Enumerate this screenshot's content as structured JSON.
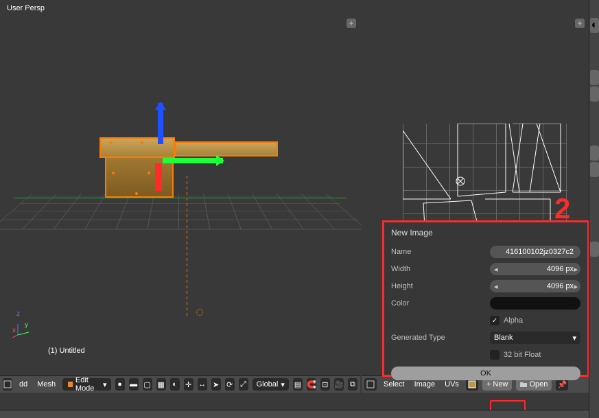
{
  "viewport3d": {
    "view_label": "User Persp",
    "image_label": "(1) Untitled",
    "axis": {
      "x": "x",
      "y": "y",
      "z": "z"
    },
    "toolbar": {
      "menu_dd": "dd",
      "menu_mesh": "Mesh",
      "mode": "Edit Mode",
      "orientation": "Global"
    }
  },
  "uv_editor": {
    "toolbar": {
      "menu_select": "Select",
      "menu_image": "Image",
      "menu_uvs": "UVs",
      "new_label": "New",
      "open_label": "Open"
    }
  },
  "new_image_popup": {
    "title": "New Image",
    "fields": {
      "name_label": "Name",
      "name_value": "416100102jz0327c2",
      "width_label": "Width",
      "width_value": "4096 px",
      "height_label": "Height",
      "height_value": "4096 px",
      "color_label": "Color",
      "color_value": "#000000",
      "alpha_label": "Alpha",
      "alpha_checked": true,
      "gentype_label": "Generated Type",
      "gentype_value": "Blank",
      "float_label": "32 bit Float",
      "float_checked": false
    },
    "ok_label": "OK"
  },
  "annotation": {
    "step": "2"
  },
  "chart_data": {
    "type": "table",
    "title": "New Image dialog",
    "fields": [
      {
        "field": "Name",
        "value": "416100102jz0327c2"
      },
      {
        "field": "Width",
        "value": 4096,
        "unit": "px"
      },
      {
        "field": "Height",
        "value": 4096,
        "unit": "px"
      },
      {
        "field": "Color",
        "value": "#000000"
      },
      {
        "field": "Alpha",
        "value": true
      },
      {
        "field": "Generated Type",
        "value": "Blank"
      },
      {
        "field": "32 bit Float",
        "value": false
      }
    ]
  }
}
